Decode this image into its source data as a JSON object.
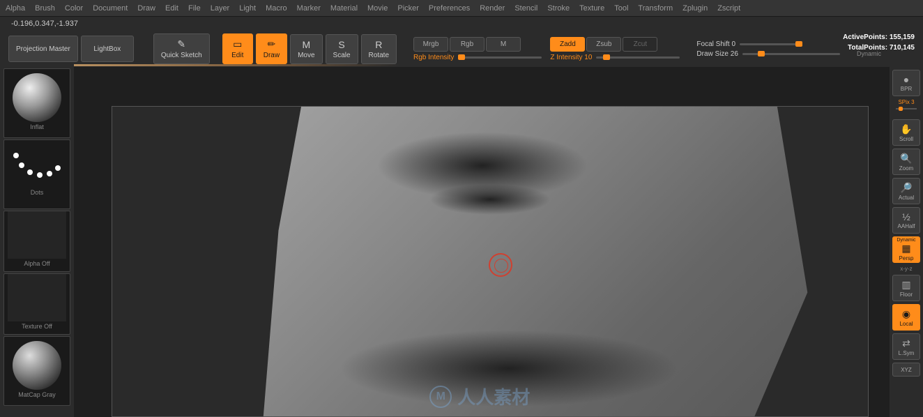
{
  "menu": [
    "Alpha",
    "Brush",
    "Color",
    "Document",
    "Draw",
    "Edit",
    "File",
    "Layer",
    "Light",
    "Macro",
    "Marker",
    "Material",
    "Movie",
    "Picker",
    "Preferences",
    "Render",
    "Stencil",
    "Stroke",
    "Texture",
    "Tool",
    "Transform",
    "Zplugin",
    "Zscript"
  ],
  "coords": "-0.196,0.347,-1.937",
  "toolbar": {
    "projection": "Projection Master",
    "lightbox": "LightBox",
    "quicksketch": "Quick Sketch",
    "edit": "Edit",
    "draw": "Draw",
    "move": "Move",
    "scale": "Scale",
    "rotate": "Rotate"
  },
  "color_modes": {
    "mrgb": "Mrgb",
    "rgb": "Rgb",
    "m": "M"
  },
  "z_modes": {
    "zadd": "Zadd",
    "zsub": "Zsub",
    "zcut": "Zcut"
  },
  "sliders": {
    "rgb_intensity": "Rgb Intensity",
    "z_intensity": "Z Intensity 10",
    "focal_shift": "Focal Shift 0",
    "draw_size": "Draw Size 26"
  },
  "stats": {
    "active_label": "ActivePoints:",
    "active_val": "155,159",
    "total_label": "TotalPoints:",
    "total_val": "710,145"
  },
  "dynamic": "Dynamic",
  "left_thumbs": {
    "inflat": "Inflat",
    "dots": "Dots",
    "alpha_off": "Alpha Off",
    "texture_off": "Texture Off",
    "matcap": "MatCap Gray"
  },
  "right_buttons": {
    "bpr": "BPR",
    "spix": "SPix 3",
    "scroll": "Scroll",
    "zoom": "Zoom",
    "actual": "Actual",
    "aahalf": "AAHalf",
    "dynamic": "Dynamic",
    "persp": "Persp",
    "xyz": "x-y-z",
    "floor": "Floor",
    "local": "Local",
    "lsym": "L.Sym",
    "xyz2": "XYZ"
  },
  "watermark": "人人素材",
  "watermark_icon": "M"
}
